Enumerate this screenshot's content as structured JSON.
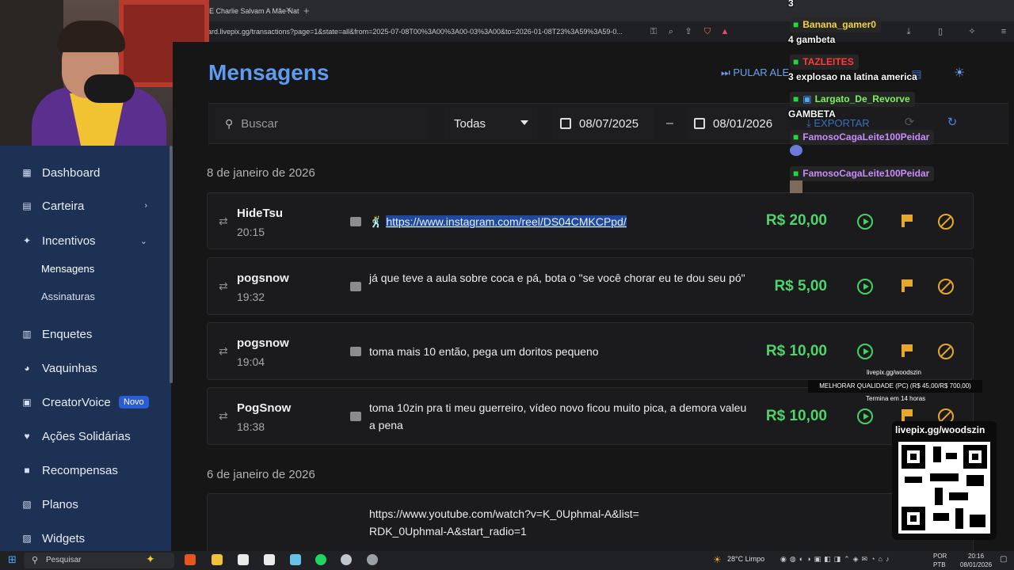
{
  "browser": {
    "tab_title": "E Charlie Salvam A Mãe Nat...",
    "url": "ard.livepix.gg/transactions?page=1&state=all&from=2025-07-08T00%3A00%3A00-03%3A00&to=2026-01-08T23%3A59%3A59-0..."
  },
  "sidebar": {
    "items": [
      {
        "label": "Dashboard",
        "icon": "dashboard-icon"
      },
      {
        "label": "Carteira",
        "icon": "wallet-icon"
      },
      {
        "label": "Incentivos",
        "icon": "sparkle-icon"
      },
      {
        "label": "Enquetes",
        "icon": "poll-icon"
      },
      {
        "label": "Vaquinhas",
        "icon": "piggy-icon"
      },
      {
        "label": "CreatorVoice",
        "icon": "voice-icon",
        "badge": "Novo"
      },
      {
        "label": "Ações Solidárias",
        "icon": "heart-icon"
      },
      {
        "label": "Recompensas",
        "icon": "gift-icon"
      },
      {
        "label": "Planos",
        "icon": "plans-icon"
      },
      {
        "label": "Widgets",
        "icon": "widgets-icon"
      }
    ],
    "subitems": [
      "Mensagens",
      "Assinaturas"
    ]
  },
  "header": {
    "title": "Mensagens",
    "skip_alert": "PULAR ALE",
    "export": "EXPORTAR"
  },
  "filters": {
    "search_placeholder": "Buscar",
    "status": "Todas",
    "date_from": "08/07/2025",
    "date_sep": "–",
    "date_to": "08/01/2026"
  },
  "groups": [
    {
      "date": "8 de janeiro de 2026",
      "rows": [
        {
          "user": "HideTsu",
          "time": "20:15",
          "message_prefix": "🕺",
          "message_link": "https://www.instagram.com/reel/DS04CMKCPpd/",
          "amount": "R$ 20,00"
        },
        {
          "user": "pogsnow",
          "time": "19:32",
          "message": "já que teve a aula sobre coca e pá, bota o \"se você chorar eu te dou seu pó\"",
          "amount": "R$ 5,00"
        },
        {
          "user": "pogsnow",
          "time": "19:04",
          "message": "toma mais 10 então, pega um doritos pequeno",
          "amount": "R$ 10,00"
        },
        {
          "user": "PogSnow",
          "time": "18:38",
          "message": "toma 10zin pra ti meu guerreiro, vídeo novo ficou muito pica, a demora valeu a pena",
          "amount": "R$ 10,00"
        }
      ]
    },
    {
      "date": "6 de janeiro de 2026",
      "rows": [
        {
          "message": "https://www.youtube.com/watch?v=K_0Uphmal-A&list=RDK_0Uphmal-A&start_radio=1"
        }
      ]
    }
  ],
  "chat": {
    "top": "3",
    "entries": [
      {
        "user": "Banana_gamer0",
        "user_color": "#f5d33c",
        "text": "4 gambeta"
      },
      {
        "user": "TAZLEITES",
        "user_color": "#ff3b3b",
        "text": "3 explosao na latina america"
      },
      {
        "user": "Largato_De_Revorve",
        "user_color": "#7cf25b",
        "text": "GAMBETA"
      },
      {
        "user": "FamosoCagaLeite100Peidar",
        "user_color": "#c98bff",
        "text": ""
      },
      {
        "user": "FamosoCagaLeite100Peidar",
        "user_color": "#c98bff",
        "text": ""
      }
    ]
  },
  "overlay": {
    "qr_title": "livepix.gg/woodszin",
    "goal_site": "livepix.gg/woodszin",
    "goal": "MELHORAR QUALIDADE (PC) (R$ 45,00/R$ 700,00)",
    "goal_ends": "Termina em 14 horas"
  },
  "taskbar": {
    "search": "Pesquisar",
    "weather": "28°C  Limpo",
    "lang1": "POR",
    "lang2": "PTB",
    "time": "20:16",
    "date": "08/01/2026"
  },
  "colors": {
    "accent": "#5d9cf0",
    "amount": "#4fd36b",
    "sidebar": "#1d3154",
    "warn": "#e5a82b"
  }
}
